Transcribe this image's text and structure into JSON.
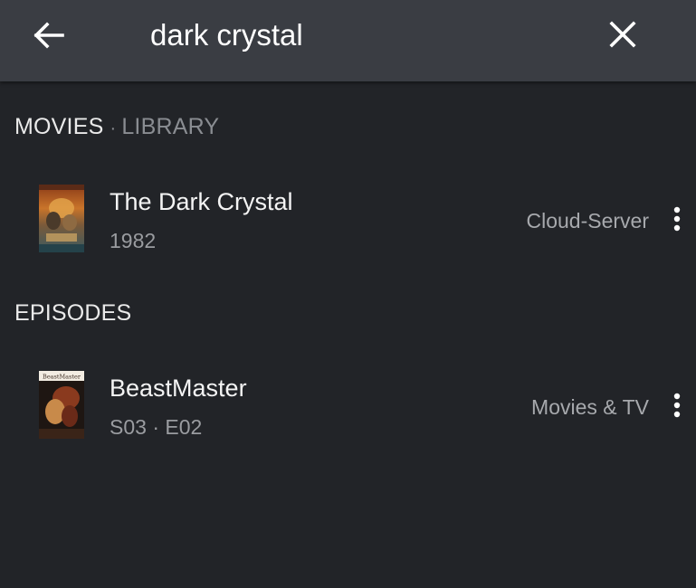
{
  "search": {
    "query": "dark crystal",
    "back_icon": "arrow-left-icon",
    "clear_icon": "close-icon"
  },
  "sections": {
    "movies": {
      "label": "MOVIES",
      "separator": "·",
      "sublabel": "LIBRARY",
      "items": [
        {
          "title": "The Dark Crystal",
          "subtitle": "1982",
          "source": "Cloud-Server",
          "more_icon": "more-vertical-icon"
        }
      ]
    },
    "episodes": {
      "label": "EPISODES",
      "items": [
        {
          "title": "BeastMaster",
          "subtitle": "S03 · E02",
          "source": "Movies & TV",
          "more_icon": "more-vertical-icon",
          "poster_text": "BeastMaster"
        }
      ]
    }
  },
  "colors": {
    "background": "#222428",
    "toolbar": "#3a3d43",
    "primary_text": "#f4f4f4",
    "secondary_text": "#9a9ca0"
  }
}
